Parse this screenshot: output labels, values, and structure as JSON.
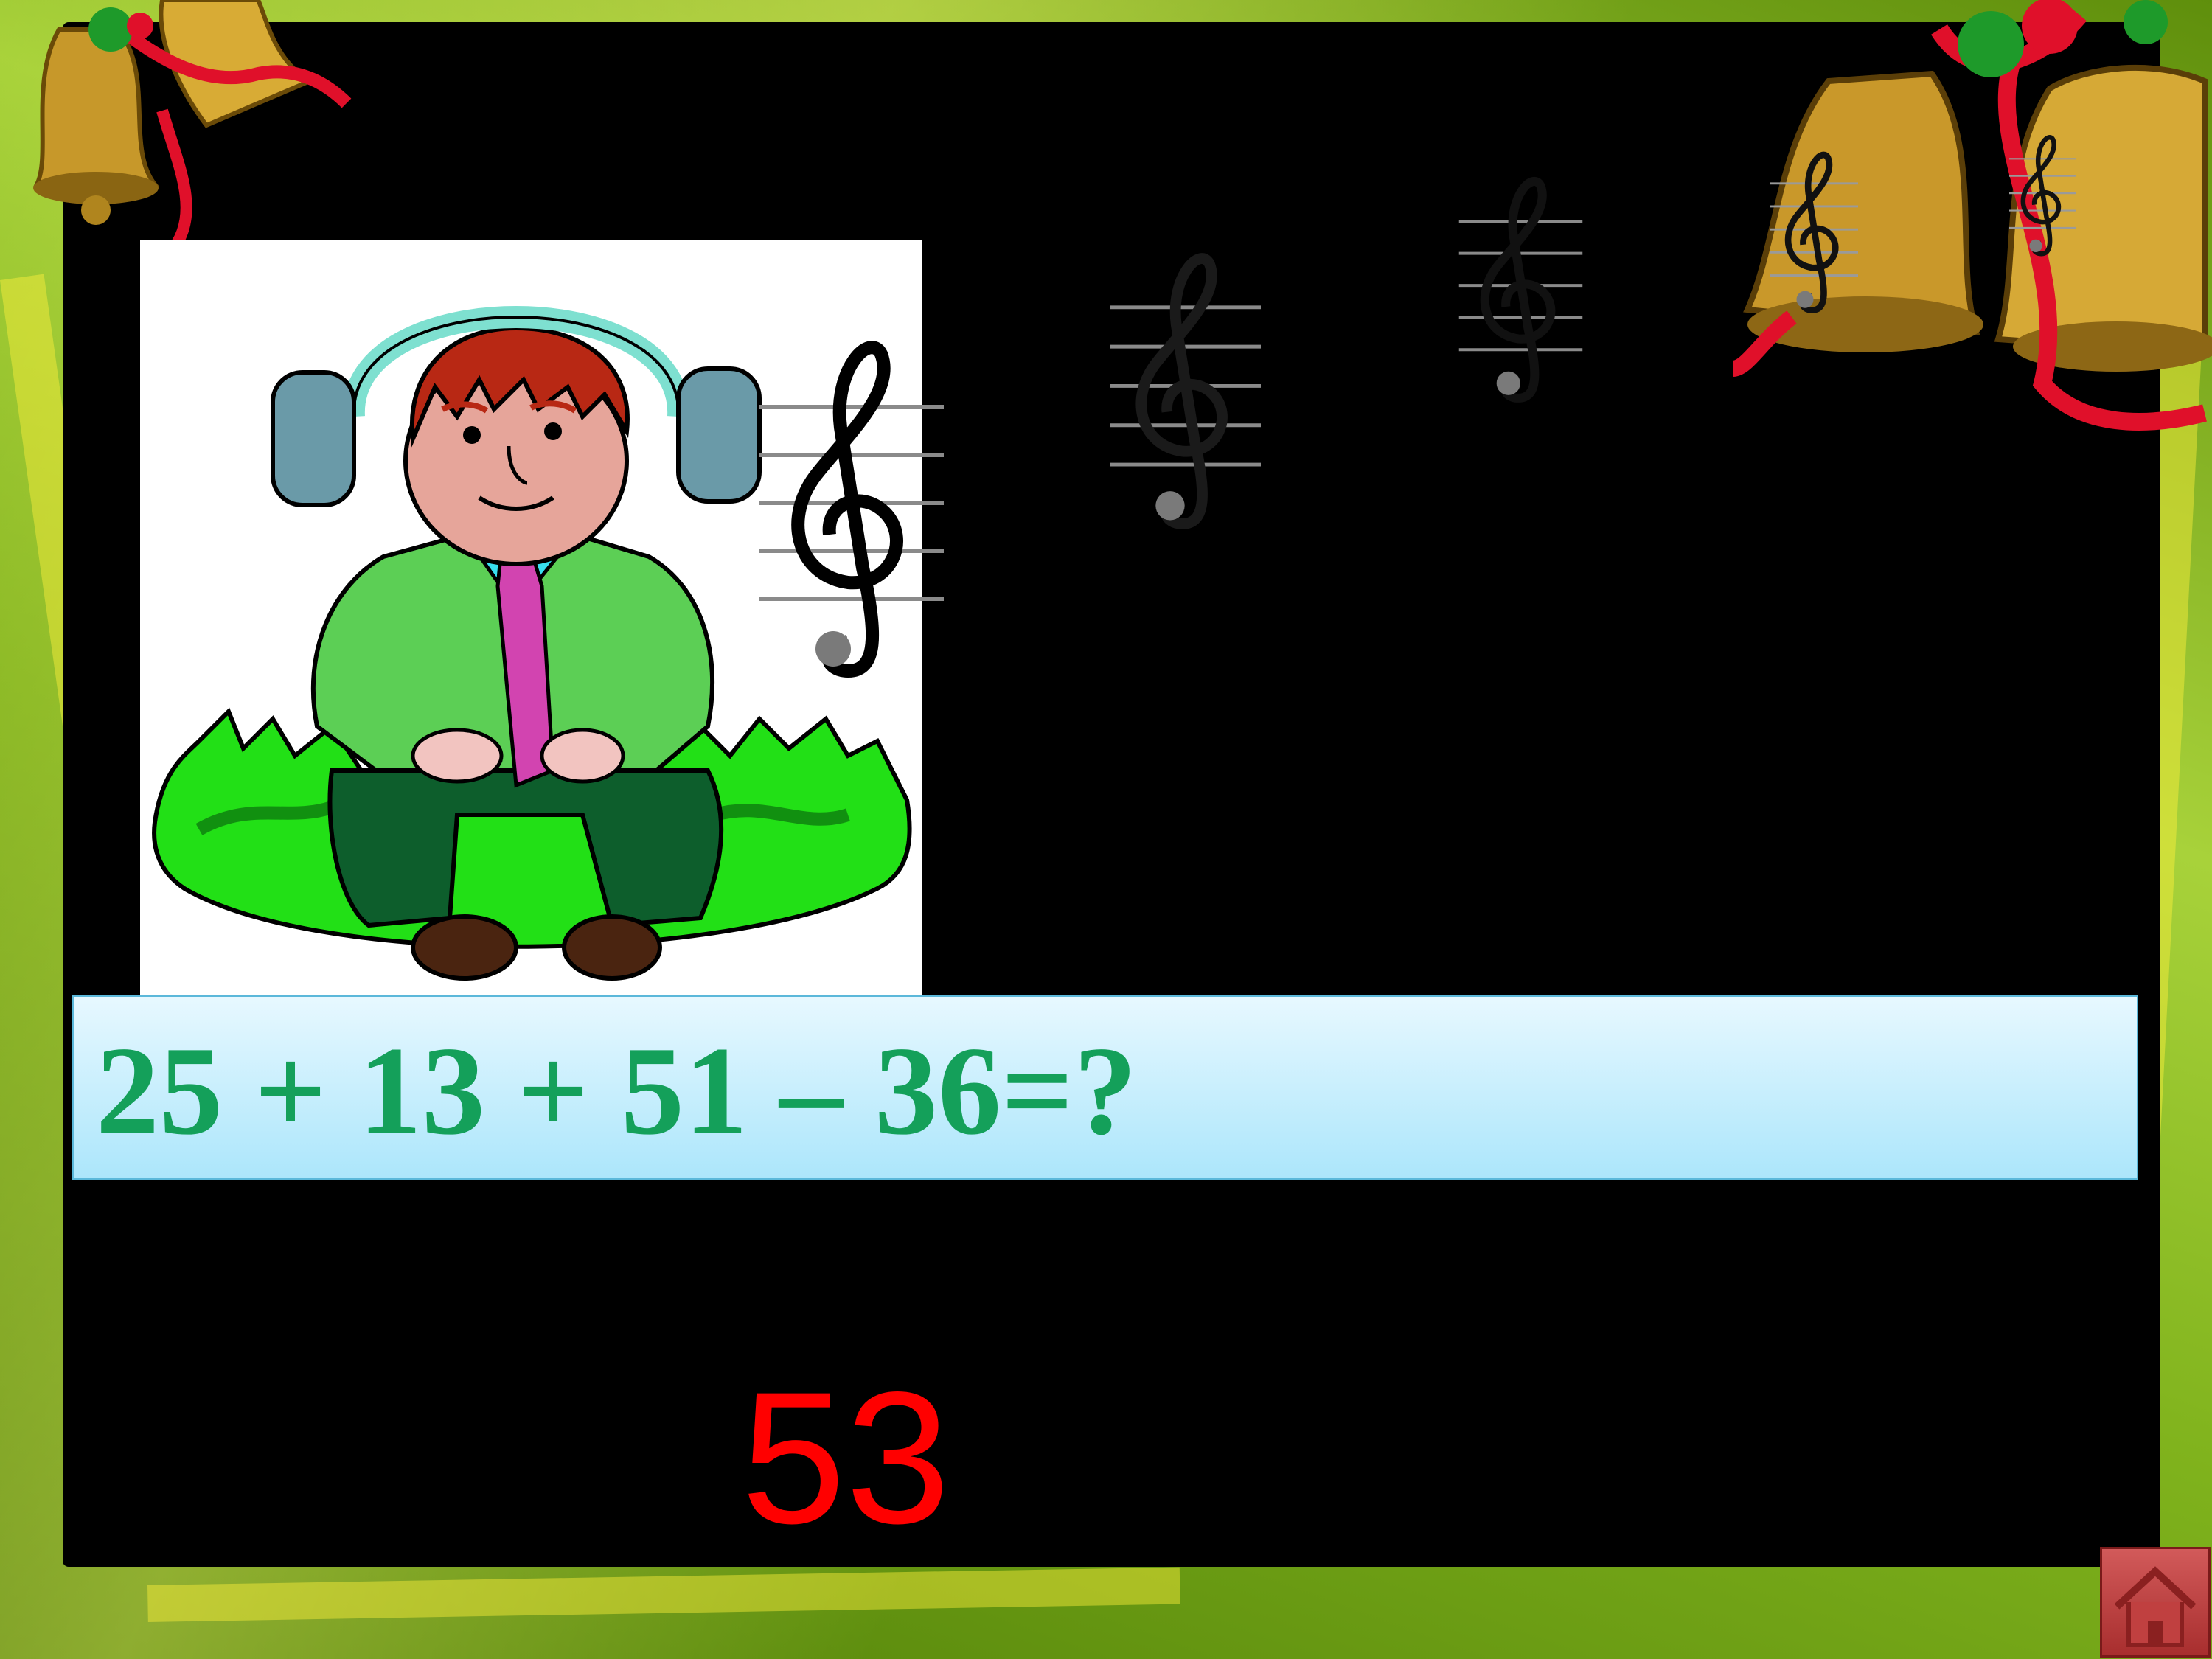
{
  "slide": {
    "equation": "25 + 13 + 51 – 36=?",
    "answer": "53"
  },
  "icons": {
    "home": "home-icon",
    "clef": "treble-clef-icon",
    "bells": "christmas-bells-icon",
    "illustration": "man-with-headphones-illustration"
  },
  "colors": {
    "equation_text": "#14a05a",
    "answer_text": "#ff0000",
    "equation_bar": "#ace6fb",
    "board": "#000000",
    "frame": "#7fae1e"
  }
}
